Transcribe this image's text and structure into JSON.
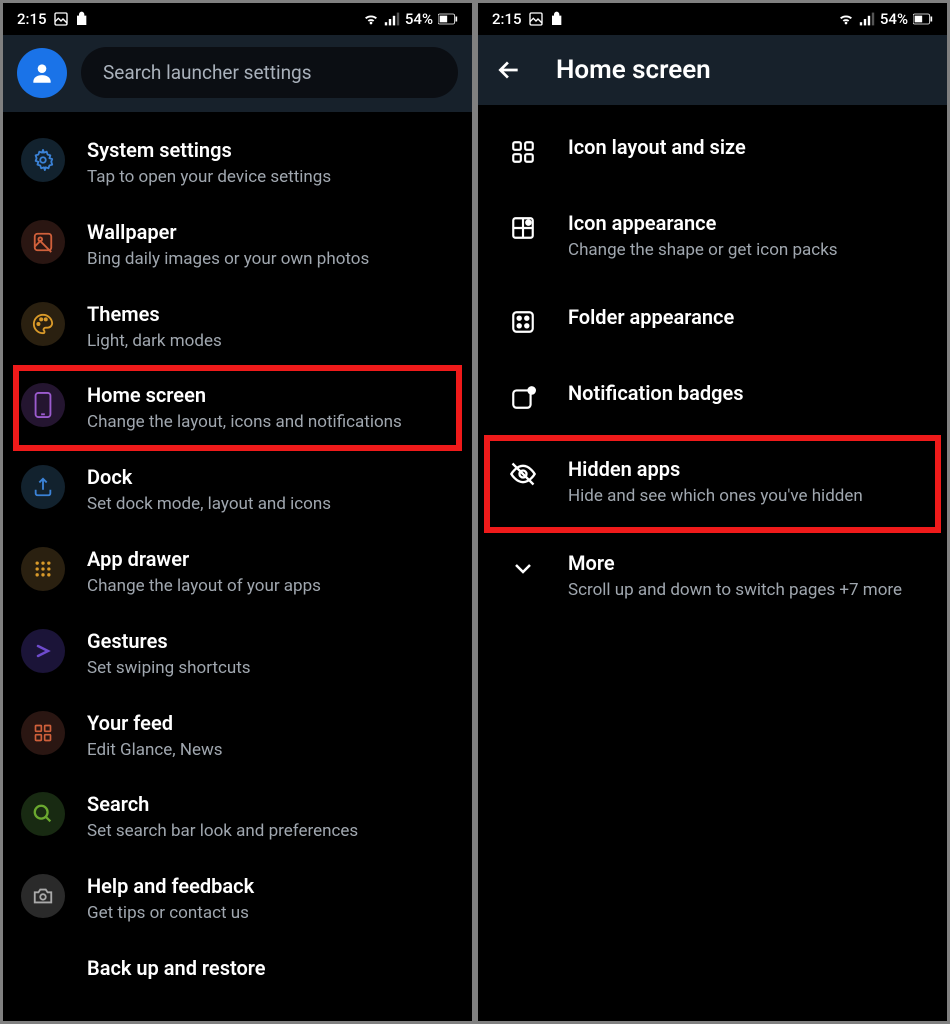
{
  "status": {
    "time": "2:15",
    "battery": "54%"
  },
  "left": {
    "search_placeholder": "Search launcher settings",
    "items": [
      {
        "title": "System settings",
        "sub": "Tap to open your device settings"
      },
      {
        "title": "Wallpaper",
        "sub": "Bing daily images or your own photos"
      },
      {
        "title": "Themes",
        "sub": "Light, dark modes"
      },
      {
        "title": "Home screen",
        "sub": "Change the layout, icons and notifications"
      },
      {
        "title": "Dock",
        "sub": "Set dock mode, layout and icons"
      },
      {
        "title": "App drawer",
        "sub": "Change the layout of your apps"
      },
      {
        "title": "Gestures",
        "sub": "Set swiping shortcuts"
      },
      {
        "title": "Your feed",
        "sub": "Edit Glance, News"
      },
      {
        "title": "Search",
        "sub": "Set search bar look and preferences"
      },
      {
        "title": "Help and feedback",
        "sub": "Get tips or contact us"
      },
      {
        "title": "Back up and restore",
        "sub": ""
      }
    ]
  },
  "right": {
    "title": "Home screen",
    "items": [
      {
        "title": "Icon layout and size",
        "sub": ""
      },
      {
        "title": "Icon appearance",
        "sub": "Change the shape or get icon packs"
      },
      {
        "title": "Folder appearance",
        "sub": ""
      },
      {
        "title": "Notification badges",
        "sub": ""
      },
      {
        "title": "Hidden apps",
        "sub": "Hide and see which ones you've hidden"
      },
      {
        "title": "More",
        "sub": "Scroll up and down to switch pages +7 more"
      }
    ]
  }
}
